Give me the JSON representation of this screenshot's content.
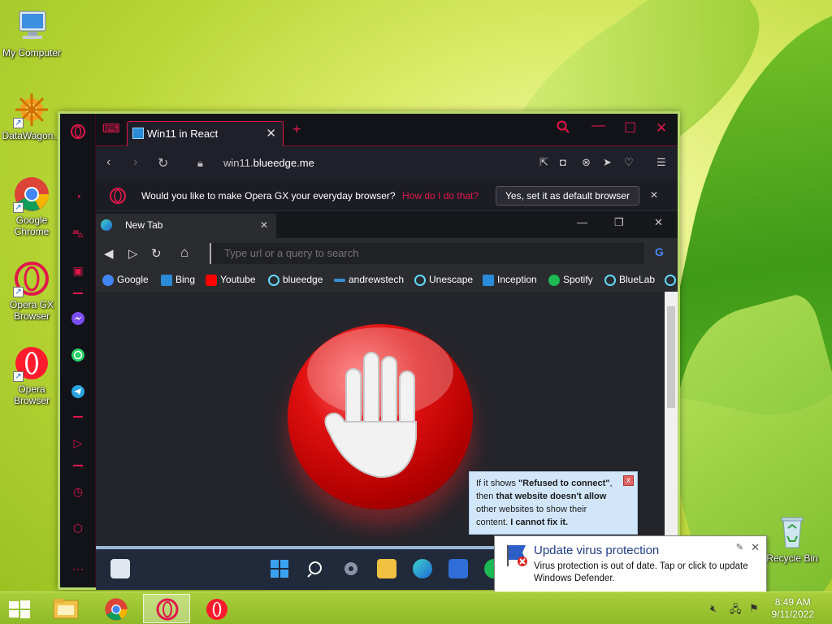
{
  "desktop": {
    "icons": [
      {
        "label": "My Computer"
      },
      {
        "label": "DataWagon..."
      },
      {
        "label": "Google Chrome"
      },
      {
        "label": "Opera GX Browser"
      },
      {
        "label": "Opera Browser"
      },
      {
        "label": "Recycle Bin"
      }
    ]
  },
  "browser": {
    "tab_title": "Win11 in React",
    "new_tab_glyph": "+",
    "url_prefix": "win11.",
    "url_domain": "blueedge.me",
    "infobar": {
      "question": "Would you like to make Opera GX your everyday browser?",
      "how_link": "How do I do that?",
      "yes_button": "Yes, set it as default browser"
    }
  },
  "inner_browser": {
    "tab_title": "New Tab",
    "url_placeholder": "Type url or a query to search",
    "bookmarks": [
      {
        "label": "Google",
        "color": "#4285f4"
      },
      {
        "label": "Bing",
        "color": "#2b8ad6"
      },
      {
        "label": "Youtube",
        "color": "#ff0000"
      },
      {
        "label": "blueedge",
        "color": "#61dafb"
      },
      {
        "label": "andrewstech",
        "color": "#3a8fd8"
      },
      {
        "label": "Unescape",
        "color": "#61dafb"
      },
      {
        "label": "Inception",
        "color": "#2a8bd8"
      },
      {
        "label": "Spotify",
        "color": "#1db954"
      },
      {
        "label": "BlueLab",
        "color": "#61dafb"
      }
    ]
  },
  "tooltip": {
    "line1_pre": "If it shows ",
    "line1_bold": "\"Refused to connect\"",
    "line1_post": ",",
    "line2_pre": "then ",
    "line2_bold": "that website doesn't allow",
    "line3": "other websites to show their",
    "line4_pre": "content. ",
    "line4_bold": "I cannot fix it."
  },
  "notification": {
    "title": "Update virus protection",
    "message": "Virus protection is out of date. Tap or click to update Windows Defender."
  },
  "taskbar": {
    "time": "8:49 AM",
    "date": "9/11/2022"
  },
  "colors": {
    "accent": "#e0184a",
    "taskbar": "#9cc430"
  }
}
